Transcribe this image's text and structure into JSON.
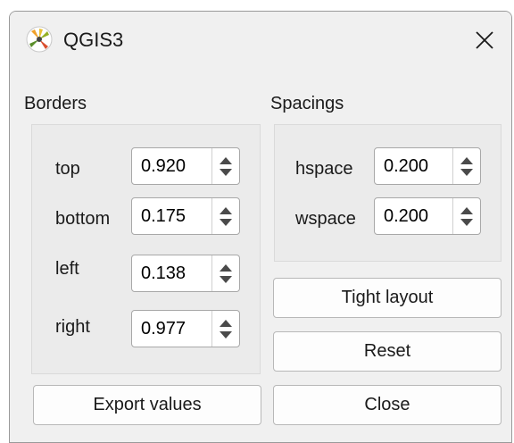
{
  "window": {
    "title": "QGIS3",
    "icon": "qgis-logo-icon",
    "close_icon": "close-icon"
  },
  "borders": {
    "label": "Borders",
    "fields": [
      {
        "label": "top",
        "value": "0.920"
      },
      {
        "label": "bottom",
        "value": "0.175"
      },
      {
        "label": "left",
        "value": "0.138"
      },
      {
        "label": "right",
        "value": "0.977"
      }
    ]
  },
  "spacings": {
    "label": "Spacings",
    "fields": [
      {
        "label": "hspace",
        "value": "0.200"
      },
      {
        "label": "wspace",
        "value": "0.200"
      }
    ]
  },
  "buttons": {
    "tight_layout": "Tight layout",
    "reset": "Reset",
    "export_values": "Export values",
    "close": "Close"
  }
}
